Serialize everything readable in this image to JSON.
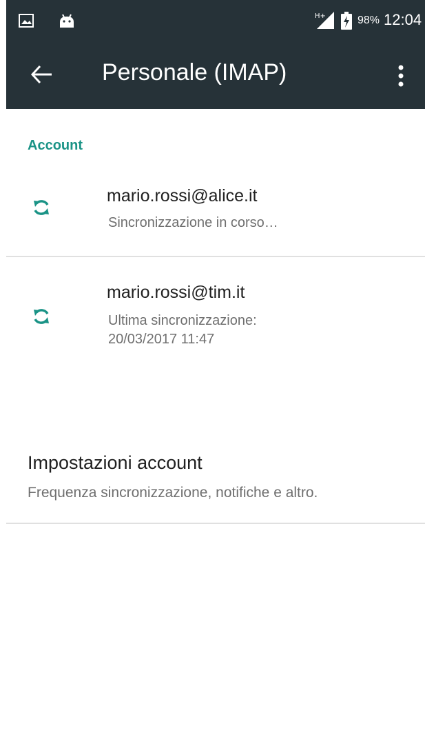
{
  "status_bar": {
    "battery_percent": "98%",
    "time": "12:04",
    "icons": [
      "gallery-icon",
      "android-icon",
      "signal-h-plus-icon",
      "battery-charging-icon"
    ]
  },
  "toolbar": {
    "title": "Personale (IMAP)",
    "back_icon": "arrow-back-icon",
    "menu_icon": "more-vert-icon"
  },
  "section": {
    "header": "Account"
  },
  "accounts": [
    {
      "email": "mario.rossi@alice.it",
      "status": "Sincronizzazione in corso…",
      "icon": "sync-icon"
    },
    {
      "email": "mario.rossi@tim.it",
      "status_line1": "Ultima sincronizzazione:",
      "status_line2": "20/03/2017 11:47",
      "icon": "sync-icon"
    }
  ],
  "settings": {
    "title": "Impostazioni account",
    "subtitle": "Frequenza sincronizzazione, notifiche e altro."
  },
  "colors": {
    "header_bg": "#263238",
    "accent": "#1a9386"
  }
}
